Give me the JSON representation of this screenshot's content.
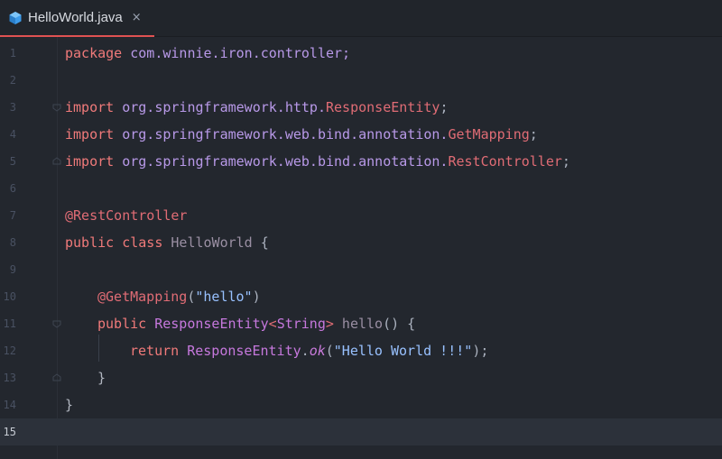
{
  "tab": {
    "filename": "HelloWorld.java",
    "close": "×"
  },
  "gutter": {
    "lines": [
      "1",
      "2",
      "3",
      "4",
      "5",
      "6",
      "7",
      "8",
      "9",
      "10",
      "11",
      "12",
      "13",
      "14",
      "15"
    ]
  },
  "code": {
    "l1_kw": "package",
    "l1_rest": " com.winnie.iron.controller;",
    "l3_kw": "import",
    "l3_pkg": " org.springframework.http.",
    "l3_cls": "ResponseEntity",
    "l3_end": ";",
    "l4_kw": "import",
    "l4_pkg": " org.springframework.web.bind.annotation.",
    "l4_cls": "GetMapping",
    "l4_end": ";",
    "l5_kw": "import",
    "l5_pkg": " org.springframework.web.bind.annotation.",
    "l5_cls": "RestController",
    "l5_end": ";",
    "l7_ann": "@RestController",
    "l8_kw1": "public",
    "l8_kw2": " class",
    "l8_cls": " HelloWorld",
    "l8_end": " {",
    "l10_ann": "@GetMapping",
    "l10_p1": "(",
    "l10_str": "\"hello\"",
    "l10_p2": ")",
    "l11_kw": "public",
    "l11_ty": " ResponseEntity",
    "l11_lt": "<",
    "l11_str": "String",
    "l11_gt": ">",
    "l11_fn": " hello",
    "l11_end": "() {",
    "l12_kw": "return",
    "l12_ty": " ResponseEntity",
    "l12_dot": ".",
    "l12_fn": "ok",
    "l12_p1": "(",
    "l12_str": "\"Hello World !!!\"",
    "l12_end": ");",
    "l13": "}",
    "l14": "}"
  },
  "colors": {
    "background": "#23272e",
    "tab_underline": "#e05252",
    "keyword": "#f07a7a",
    "string": "#98c1ff"
  }
}
